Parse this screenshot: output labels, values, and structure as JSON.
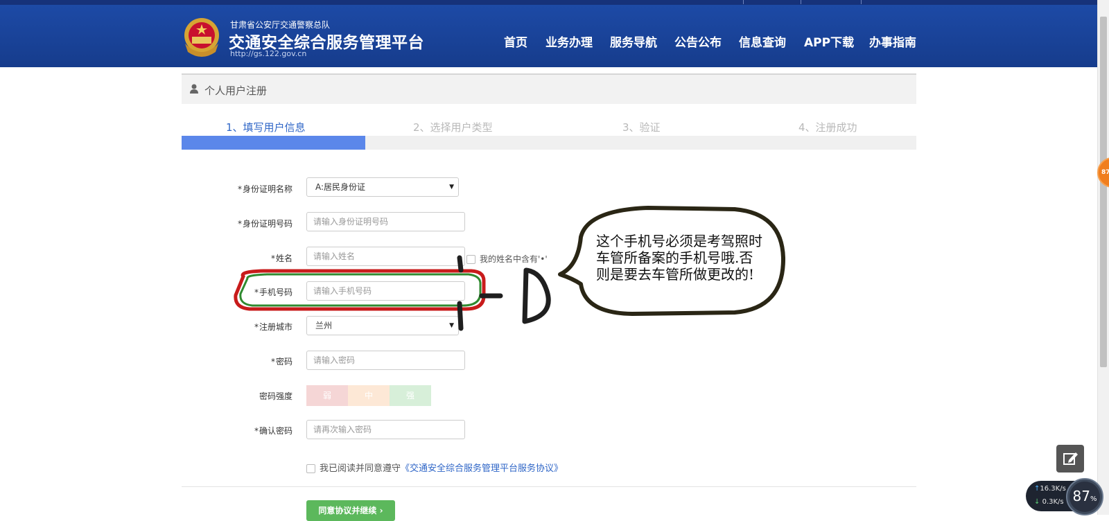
{
  "header": {
    "subtitle": "甘肃省公安厅交通警察总队",
    "title": "交通安全综合服务管理平台",
    "url": "http://gs.122.gov.cn",
    "nav": [
      "首页",
      "业务办理",
      "服务导航",
      "公告公布",
      "信息查询",
      "APP下载",
      "办事指南"
    ]
  },
  "panel": {
    "icon": "user-icon",
    "title": "个人用户注册"
  },
  "steps": [
    {
      "label": "1、填写用户信息",
      "active": true
    },
    {
      "label": "2、选择用户类型",
      "active": false
    },
    {
      "label": "3、验证",
      "active": false
    },
    {
      "label": "4、注册成功",
      "active": false
    }
  ],
  "progress": {
    "completed_fraction": 0.25,
    "fill_color": "#5b87ea"
  },
  "form": {
    "id_type": {
      "label": "身份证明名称",
      "value": "A:居民身份证"
    },
    "id_number": {
      "label": "身份证明号码",
      "placeholder": "请输入身份证明号码"
    },
    "name": {
      "label": "姓名",
      "placeholder": "请输入姓名",
      "checkbox_label": "我的姓名中含有'•'"
    },
    "phone": {
      "label": "手机号码",
      "placeholder": "请输入手机号码"
    },
    "city": {
      "label": "注册城市",
      "value": "兰州"
    },
    "password": {
      "label": "密码",
      "placeholder": "请输入密码"
    },
    "strength": {
      "label": "密码强度",
      "levels": [
        "弱",
        "中",
        "强"
      ]
    },
    "confirm": {
      "label": "确认密码",
      "placeholder": "请再次输入密码"
    },
    "required_mark": "*",
    "agree": {
      "prefix": "我已阅读并同意遵守",
      "link": "《交通安全综合服务管理平台服务协议》"
    },
    "submit": "同意协议并继续"
  },
  "annotation": {
    "note": "这个手机号必须是考驾照时车管所备案的手机号哦.否则是要去车管所做更改的!"
  },
  "widgets": {
    "badge": "87",
    "net_up": "16.3K/s",
    "net_down": "0.3K/s",
    "gauge_pct": "87",
    "gauge_unit": "%"
  },
  "colors": {
    "header_blue": "#1d4aa6",
    "active_step": "#2f66c7",
    "submit_green": "#5cb85c",
    "weak": "#f5d6d6",
    "medium": "#fde8d6",
    "strong": "#d7efd9"
  }
}
